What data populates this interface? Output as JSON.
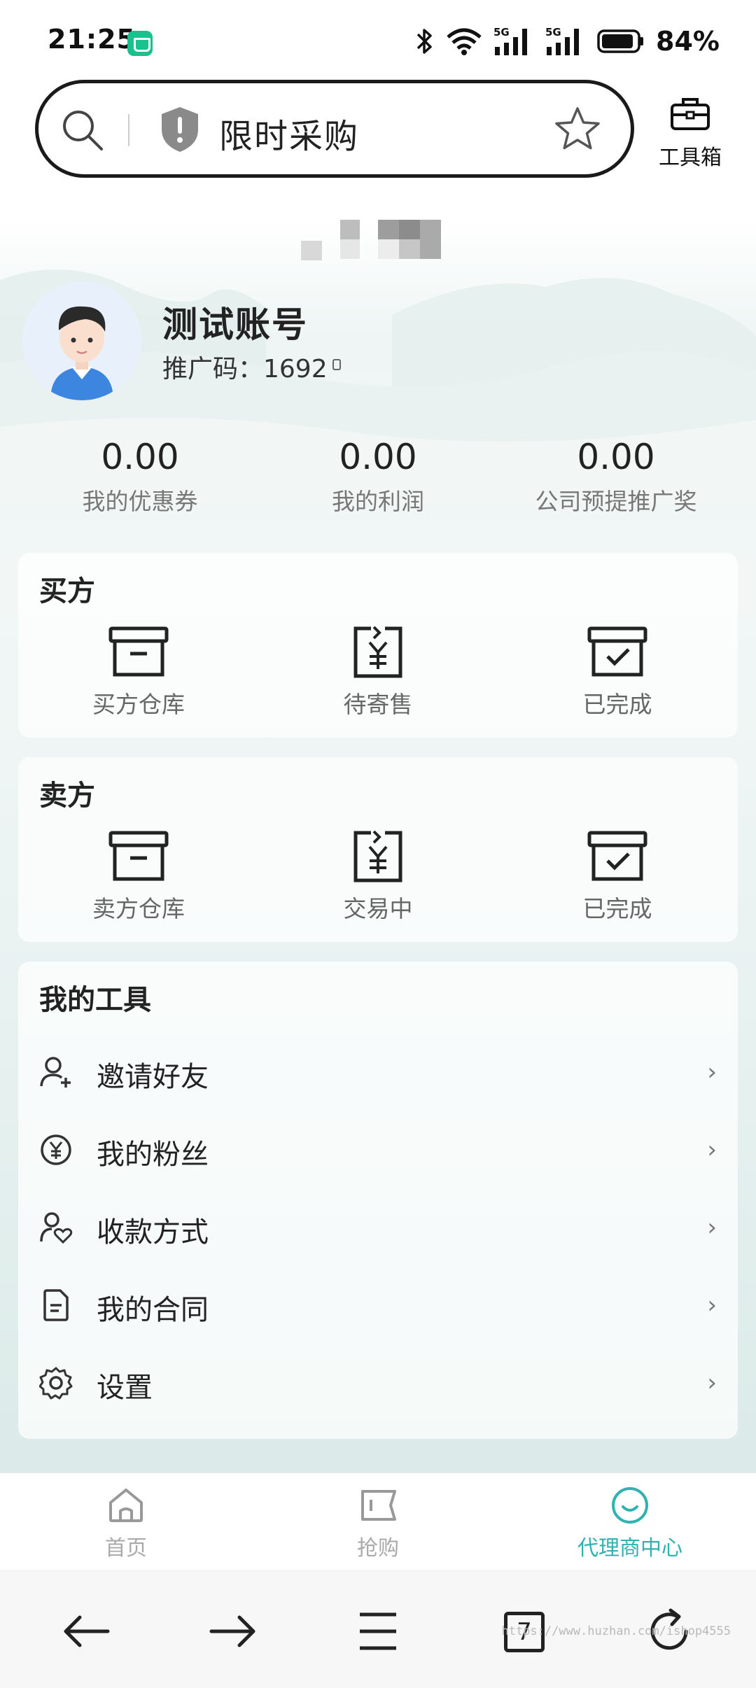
{
  "status_bar": {
    "time": "21:25",
    "battery": "84%",
    "network": "5G"
  },
  "search": {
    "text": "限时采购"
  },
  "toolbox": {
    "label": "工具箱"
  },
  "profile": {
    "name": "测试账号",
    "referral": "推广码：1692"
  },
  "stats": [
    {
      "value": "0.00",
      "label": "我的优惠券"
    },
    {
      "value": "0.00",
      "label": "我的利润"
    },
    {
      "value": "0.00",
      "label": "公司预提推广奖"
    }
  ],
  "buyer": {
    "title": "买方",
    "items": [
      {
        "label": "买方仓库",
        "icon": "archive-box-icon"
      },
      {
        "label": "待寄售",
        "icon": "yuan-transfer-icon"
      },
      {
        "label": "已完成",
        "icon": "archive-check-icon"
      }
    ]
  },
  "seller": {
    "title": "卖方",
    "items": [
      {
        "label": "卖方仓库",
        "icon": "archive-box-icon"
      },
      {
        "label": "交易中",
        "icon": "yuan-transfer-icon"
      },
      {
        "label": "已完成",
        "icon": "archive-check-icon"
      }
    ]
  },
  "tools": {
    "title": "我的工具",
    "items": [
      {
        "label": "邀请好友",
        "icon": "user-add-icon"
      },
      {
        "label": "我的粉丝",
        "icon": "yuan-circle-icon"
      },
      {
        "label": "收款方式",
        "icon": "user-heart-icon"
      },
      {
        "label": "我的合同",
        "icon": "document-icon"
      },
      {
        "label": "设置",
        "icon": "gear-icon"
      }
    ]
  },
  "tabs": [
    {
      "label": "首页",
      "icon": "home-icon",
      "active": false
    },
    {
      "label": "抢购",
      "icon": "ticket-icon",
      "active": false
    },
    {
      "label": "代理商中心",
      "icon": "smile-icon",
      "active": true
    }
  ],
  "browser_nav": {
    "tab_count": "7",
    "watermark": "https://www.huzhan.com/ishop4555"
  },
  "colors": {
    "accent": "#2fb2b0",
    "text": "#222222",
    "muted": "#777777"
  }
}
